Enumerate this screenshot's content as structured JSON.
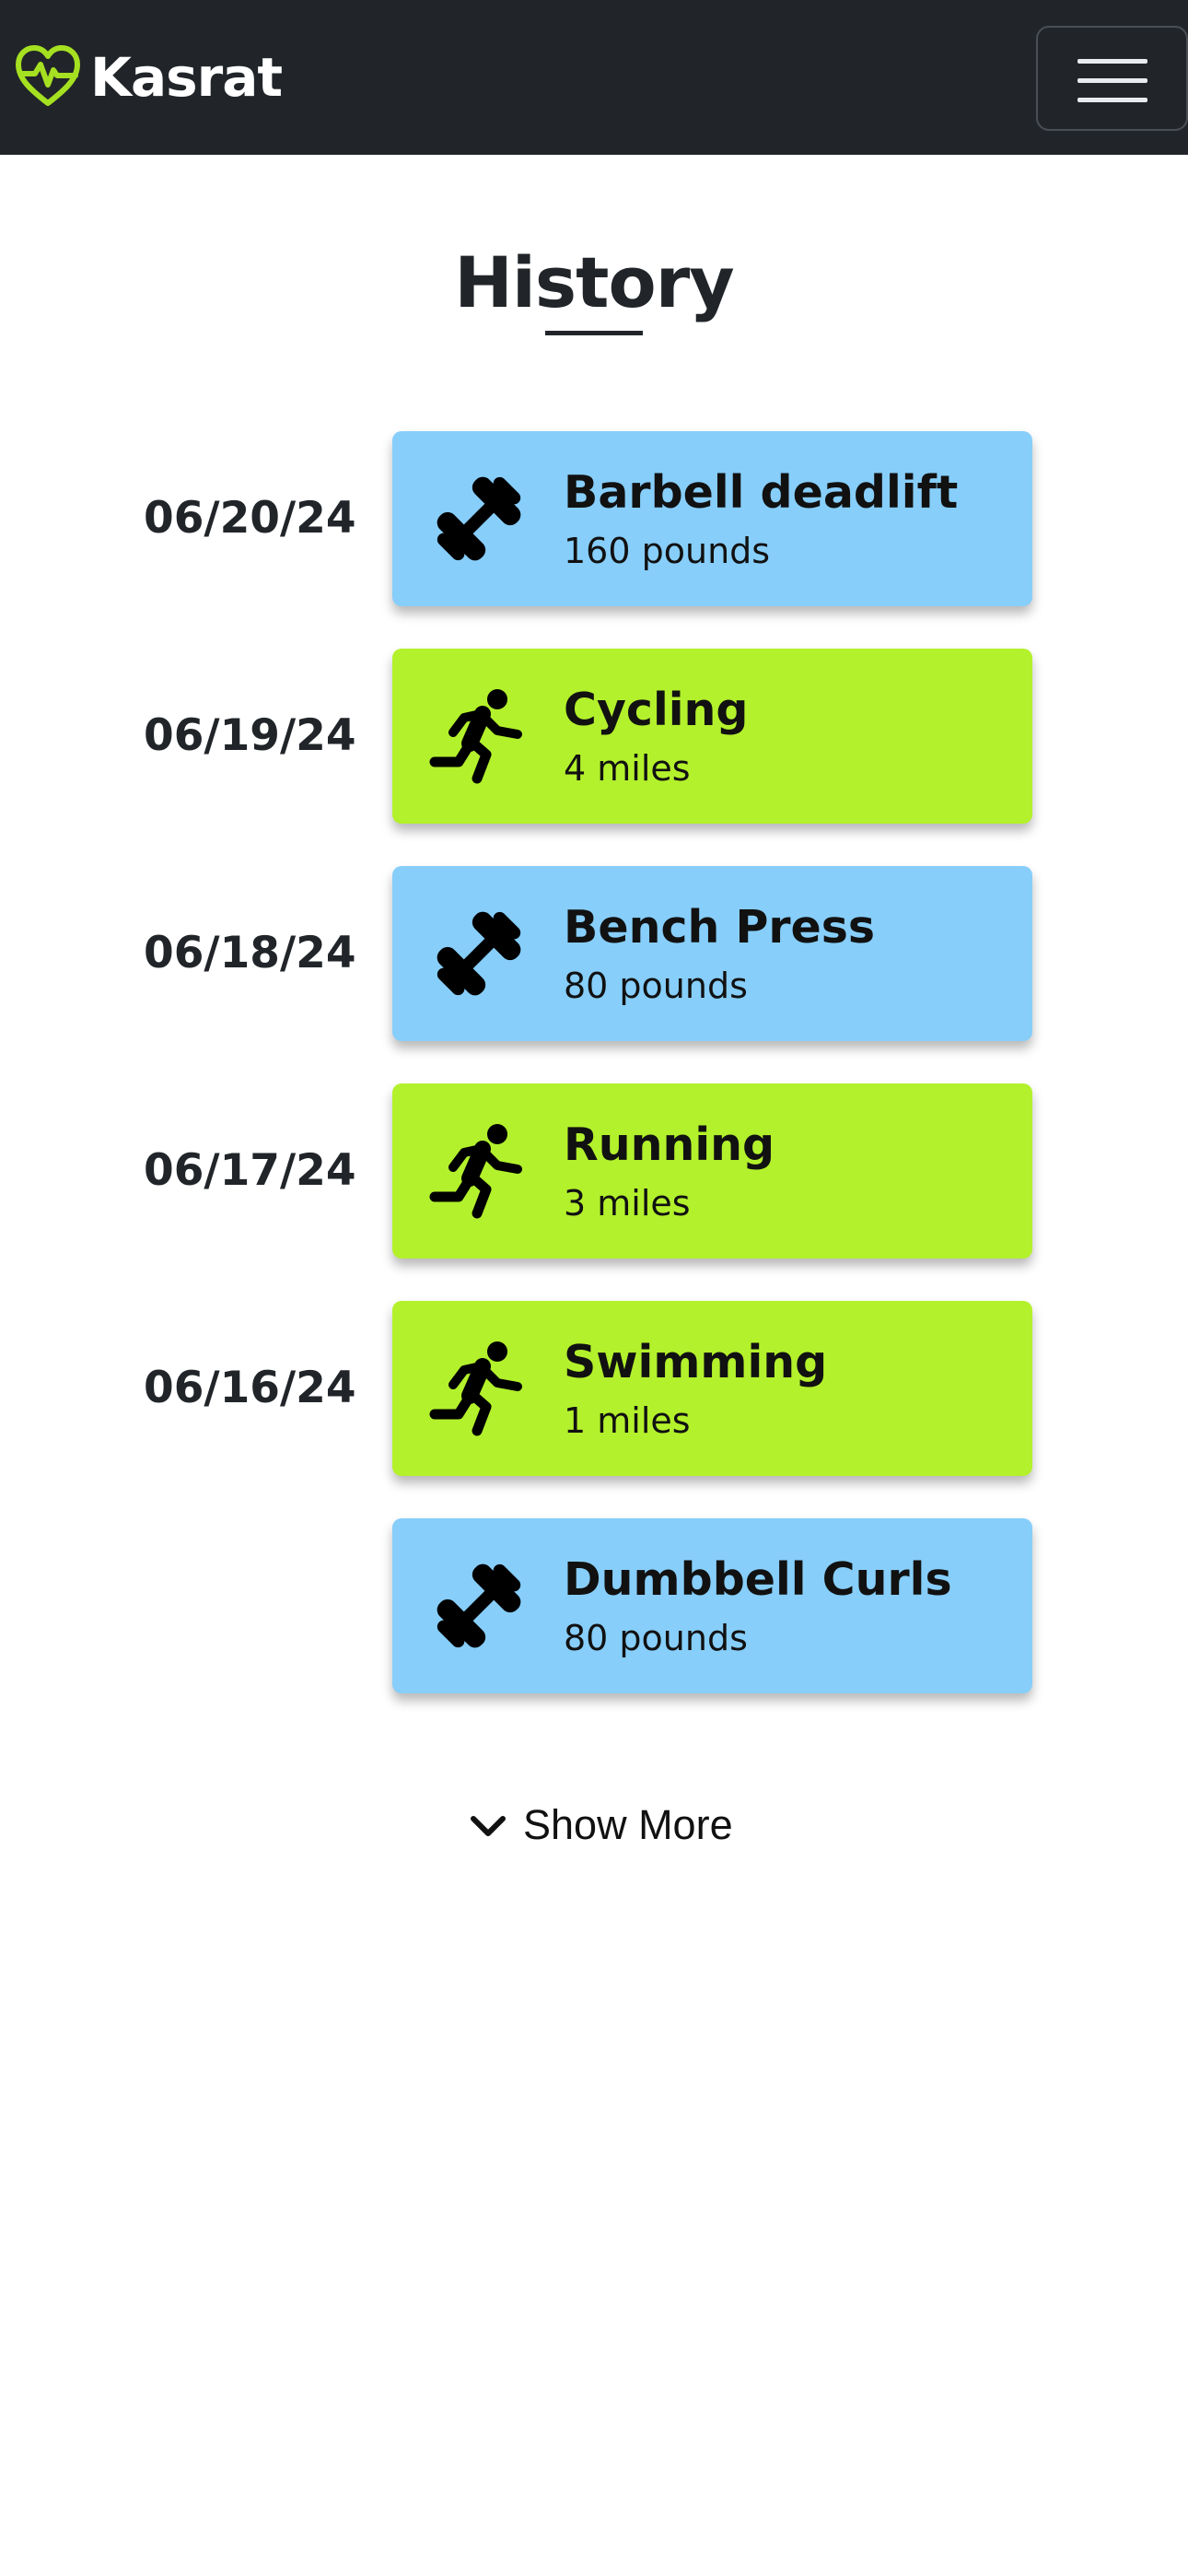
{
  "navbar": {
    "brand_name": "Kasrat",
    "brand_color": "#a5e021",
    "background": "#212529",
    "menu_icon": "hamburger-icon"
  },
  "page": {
    "title": "History"
  },
  "history": [
    {
      "date": "06/20/24",
      "name": "Barbell deadlift",
      "detail": "160 pounds",
      "type": "weights",
      "icon": "dumbbell-icon",
      "color": "#87cefa"
    },
    {
      "date": "06/19/24",
      "name": "Cycling",
      "detail": "4 miles",
      "type": "cardio",
      "icon": "running-person-icon",
      "color": "#b3f12c"
    },
    {
      "date": "06/18/24",
      "name": "Bench Press",
      "detail": "80 pounds",
      "type": "weights",
      "icon": "dumbbell-icon",
      "color": "#87cefa"
    },
    {
      "date": "06/17/24",
      "name": "Running",
      "detail": "3 miles",
      "type": "cardio",
      "icon": "running-person-icon",
      "color": "#b3f12c"
    },
    {
      "date": "06/16/24",
      "name": "Swimming",
      "detail": "1 miles",
      "type": "cardio",
      "icon": "running-person-icon",
      "color": "#b3f12c"
    },
    {
      "date": "",
      "name": "Dumbbell Curls",
      "detail": "80 pounds",
      "type": "weights",
      "icon": "dumbbell-icon",
      "color": "#87cefa"
    }
  ],
  "show_more": {
    "label": "Show More",
    "icon": "chevron-down-icon"
  }
}
